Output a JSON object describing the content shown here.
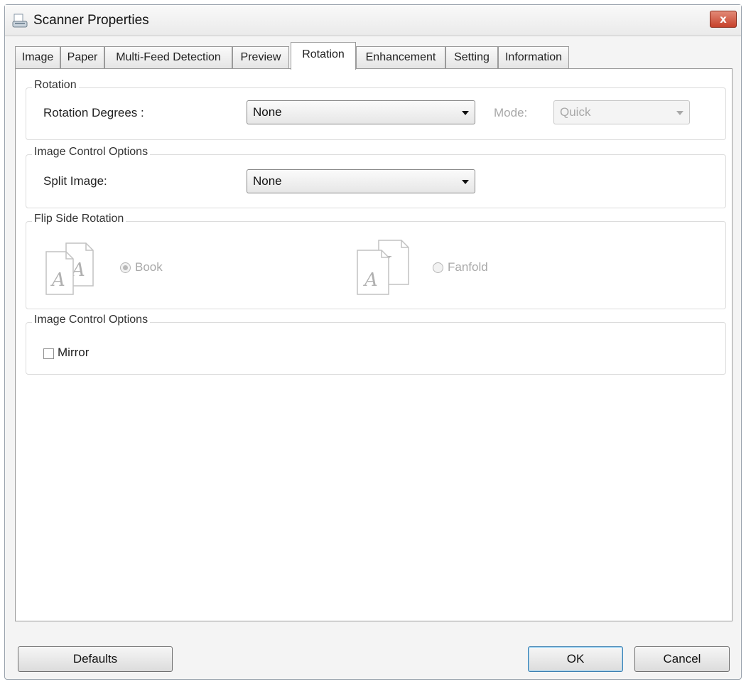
{
  "window": {
    "title": "Scanner Properties",
    "close_label": "x"
  },
  "tabs": [
    {
      "label": "Image"
    },
    {
      "label": "Paper"
    },
    {
      "label": "Multi-Feed Detection"
    },
    {
      "label": "Preview"
    },
    {
      "label": "Rotation",
      "active": true
    },
    {
      "label": "Enhancement"
    },
    {
      "label": "Setting"
    },
    {
      "label": "Information"
    }
  ],
  "rotation": {
    "group_title": "Rotation",
    "degrees_label": "Rotation Degrees :",
    "degrees_value": "None",
    "mode_label": "Mode:",
    "mode_value": "Quick"
  },
  "image_control": {
    "group_title": "Image Control Options",
    "split_label": "Split Image:",
    "split_value": "None"
  },
  "flip_side": {
    "group_title": "Flip Side Rotation",
    "book_label": "Book",
    "book_selected": true,
    "fanfold_label": "Fanfold",
    "fanfold_selected": false,
    "icon_glyph": "A"
  },
  "image_control_2": {
    "group_title": "Image Control Options",
    "mirror_label": "Mirror",
    "mirror_checked": false
  },
  "buttons": {
    "defaults": "Defaults",
    "ok": "OK",
    "cancel": "Cancel"
  }
}
